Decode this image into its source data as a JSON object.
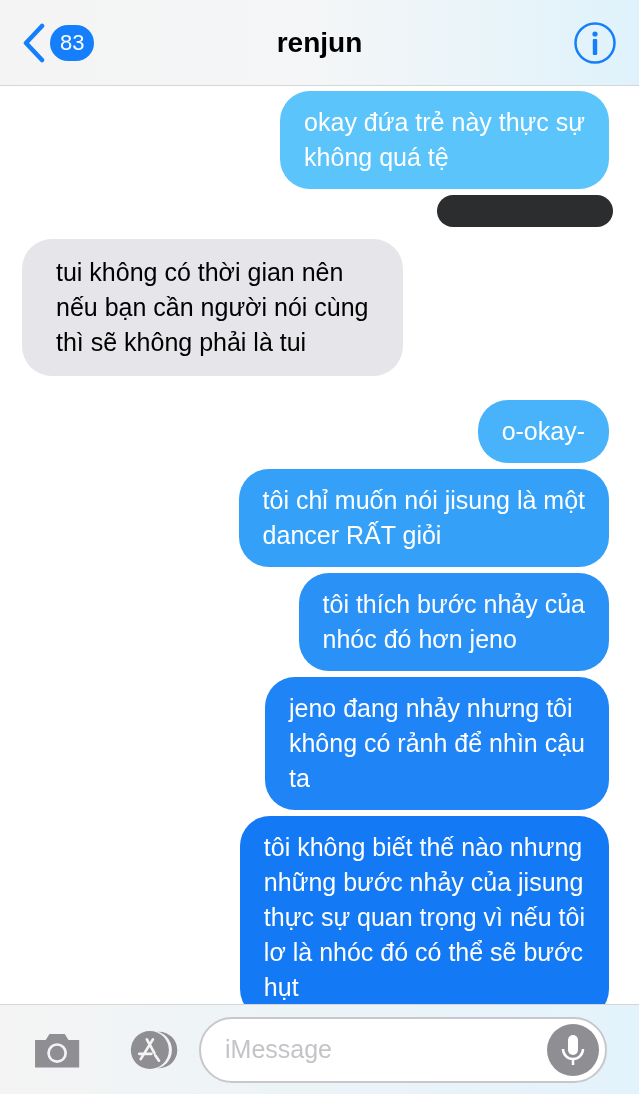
{
  "header": {
    "back_badge": "83",
    "title": "renjun"
  },
  "messages": [
    {
      "kind": "sent",
      "text": "okay đứa trẻ này thực sự\nkhông quá tệ"
    },
    {
      "kind": "redacted"
    },
    {
      "kind": "received",
      "text": "tui không có thời gian nên\nnếu bạn cần người nói cùng\nthì sẽ không phải là tui"
    },
    {
      "kind": "sent",
      "text": "o-okay-"
    },
    {
      "kind": "sent",
      "text": "tôi chỉ muốn nói jisung là một\ndancer RẤT giỏi"
    },
    {
      "kind": "sent",
      "text": "tôi thích bước nhảy của\nnhóc đó hơn jeno"
    },
    {
      "kind": "sent",
      "text": "jeno đang nhảy nhưng tôi\nkhông có rảnh để nhìn cậu\nta"
    },
    {
      "kind": "sent",
      "text": "tôi không biết thế nào nhưng\nnhững bước nhảy của jisung\nthực sự quan trọng vì nếu tôi\nlơ là nhóc đó có thể sẽ bước\nhụt"
    }
  ],
  "composer": {
    "placeholder": "iMessage"
  }
}
